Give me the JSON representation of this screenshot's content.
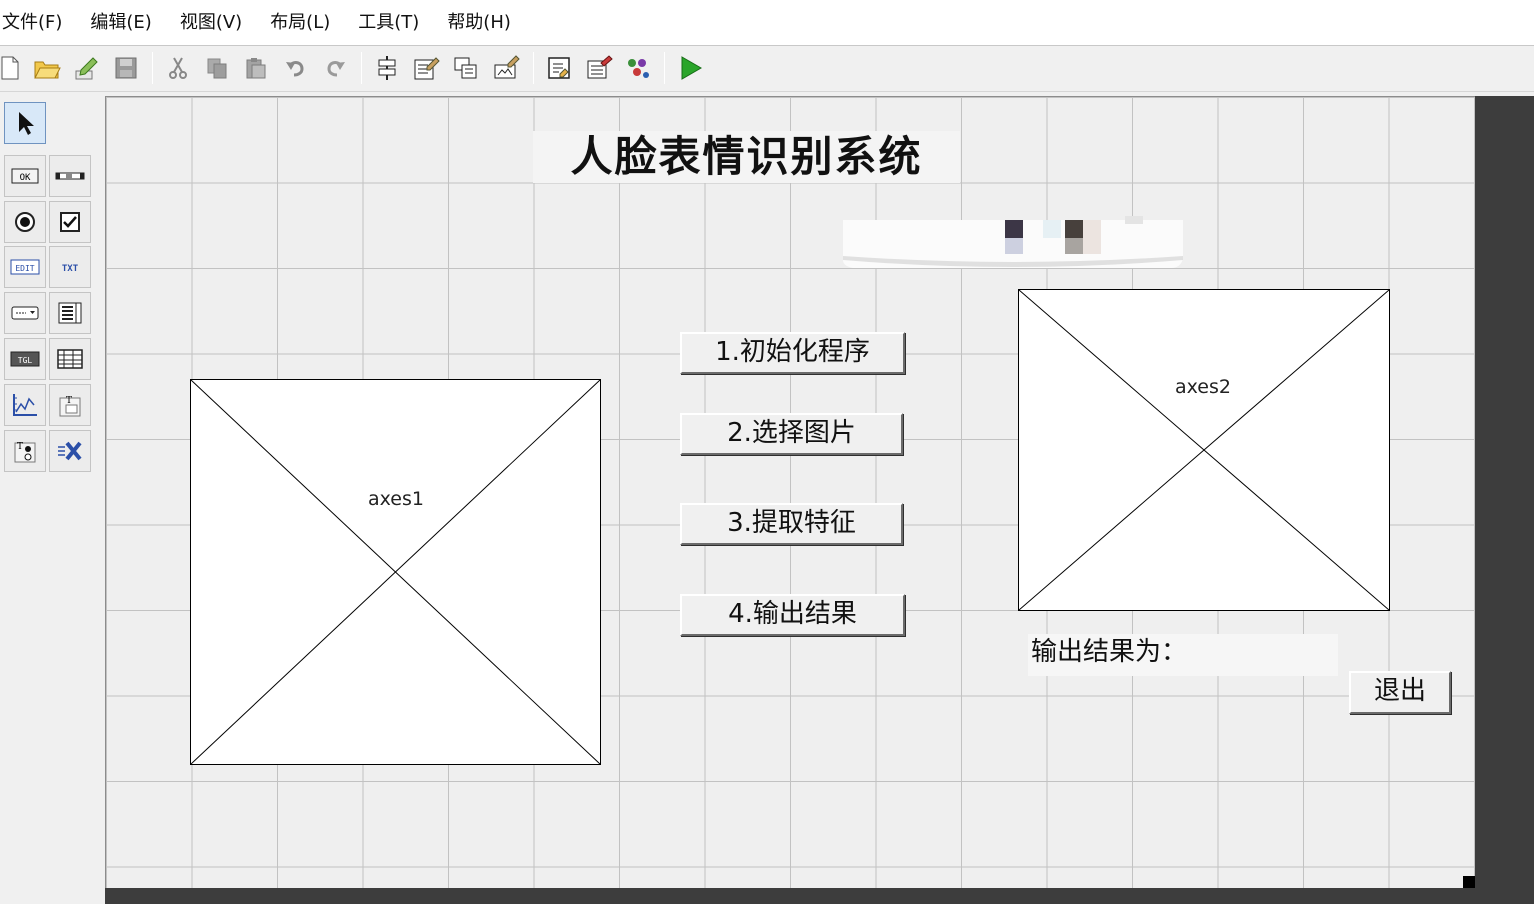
{
  "menu": [
    "文件(F)",
    "编辑(E)",
    "视图(V)",
    "布局(L)",
    "工具(T)",
    "帮助(H)"
  ],
  "toolbar_icons": [
    "new-file-icon",
    "open-folder-icon",
    "edit-icon",
    "save-icon",
    "cut-icon",
    "copy-icon",
    "paste-icon",
    "undo-icon",
    "redo-icon",
    "align-icon",
    "menu-editor-icon",
    "tab-order-icon",
    "toolbar-editor-icon",
    "m-file-editor-icon",
    "property-inspector-icon",
    "object-browser-icon",
    "run-icon"
  ],
  "palette": {
    "select": "↖",
    "pushbutton": "OK",
    "edit": "EDIT",
    "text": "TXT",
    "toggle": "TGL"
  },
  "figure": {
    "title": "人脸表情识别系统",
    "axes1_label": "axes1",
    "axes2_label": "axes2",
    "buttons": {
      "init": "1.初始化程序",
      "select_image": "2.选择图片",
      "extract_features": "3.提取特征",
      "output_result": "4.输出结果",
      "exit": "退出"
    },
    "result_label": "输出结果为："
  },
  "colors": {
    "canvas": "#efefef",
    "grid": "#c2c2c2",
    "dark_border": "#3d3d3d",
    "run_green": "#2aa52a"
  }
}
